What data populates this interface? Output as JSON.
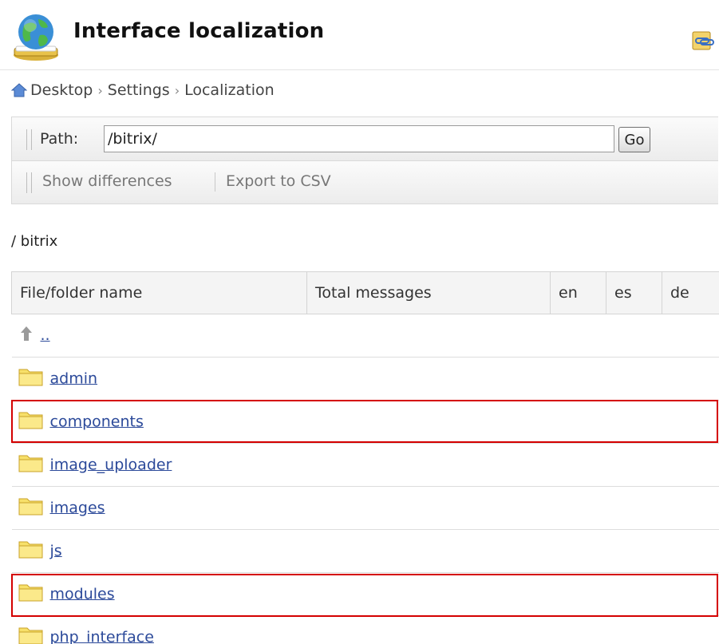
{
  "header": {
    "title": "Interface localization",
    "logo_icon": "globe-book-icon",
    "corner_icon": "link-icon"
  },
  "breadcrumb": {
    "items": [
      "Desktop",
      "Settings",
      "Localization"
    ],
    "separator": "›"
  },
  "path_bar": {
    "label": "Path:",
    "value": "/bitrix/",
    "go_label": "Go"
  },
  "actions": {
    "show_differences": "Show differences",
    "export_csv": "Export to CSV"
  },
  "current_path": "/ bitrix",
  "table": {
    "columns": [
      "File/folder name",
      "Total messages",
      "en",
      "es",
      "de"
    ],
    "up_link": "..",
    "rows": [
      {
        "name": "admin"
      },
      {
        "name": "components"
      },
      {
        "name": "image_uploader"
      },
      {
        "name": "images"
      },
      {
        "name": "js"
      },
      {
        "name": "modules"
      },
      {
        "name": "php_interface"
      }
    ]
  },
  "colors": {
    "link": "#2c4a9a",
    "highlight": "#d40000",
    "folder": "#f7e06a"
  }
}
